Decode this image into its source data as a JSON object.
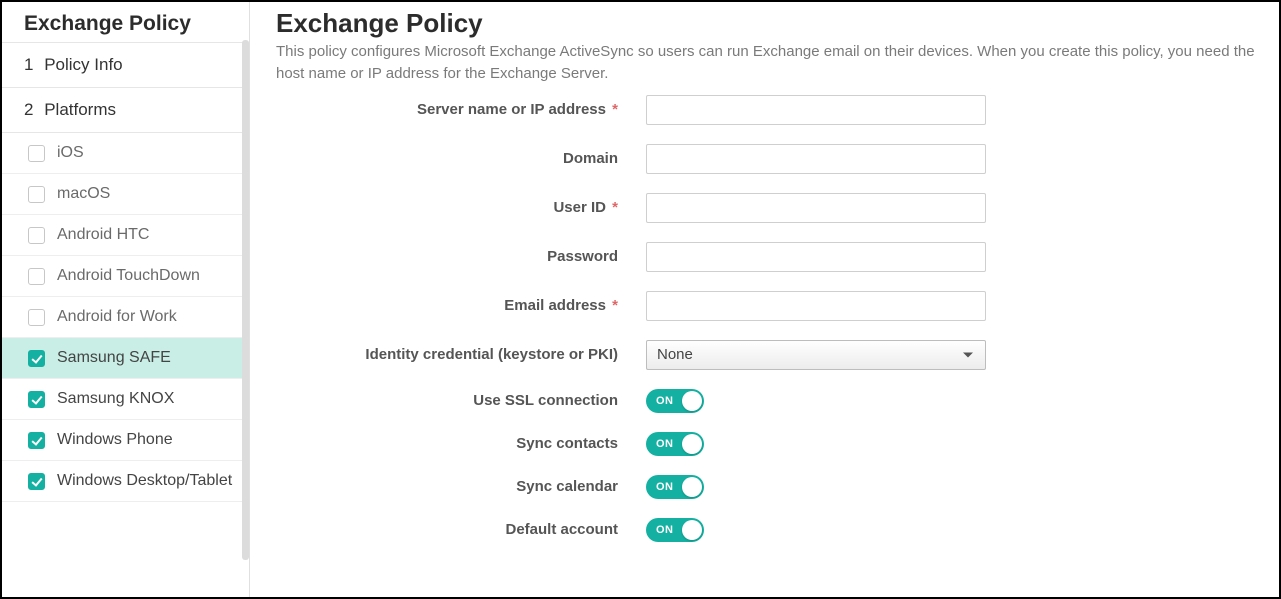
{
  "sidebar": {
    "title": "Exchange Policy",
    "steps": [
      {
        "num": "1",
        "label": "Policy Info"
      },
      {
        "num": "2",
        "label": "Platforms"
      }
    ],
    "platforms": [
      {
        "label": "iOS",
        "checked": false,
        "active": false
      },
      {
        "label": "macOS",
        "checked": false,
        "active": false
      },
      {
        "label": "Android HTC",
        "checked": false,
        "active": false
      },
      {
        "label": "Android TouchDown",
        "checked": false,
        "active": false
      },
      {
        "label": "Android for Work",
        "checked": false,
        "active": false
      },
      {
        "label": "Samsung SAFE",
        "checked": true,
        "active": true
      },
      {
        "label": "Samsung KNOX",
        "checked": true,
        "active": false
      },
      {
        "label": "Windows Phone",
        "checked": true,
        "active": false
      },
      {
        "label": "Windows Desktop/Tablet",
        "checked": true,
        "active": false
      }
    ]
  },
  "main": {
    "title": "Exchange Policy",
    "description": "This policy configures Microsoft Exchange ActiveSync so users can run Exchange email on their devices. When you create this policy, you need the host name or IP address for the Exchange Server.",
    "fields": {
      "server_label": "Server name or IP address",
      "server_value": "",
      "domain_label": "Domain",
      "domain_value": "",
      "userid_label": "User ID",
      "userid_value": "",
      "password_label": "Password",
      "password_value": "",
      "email_label": "Email address",
      "email_value": "",
      "identity_label": "Identity credential (keystore or PKI)",
      "identity_value": "None",
      "ssl_label": "Use SSL connection",
      "sync_contacts_label": "Sync contacts",
      "sync_calendar_label": "Sync calendar",
      "default_account_label": "Default account"
    },
    "toggle_states": {
      "ssl": "ON",
      "sync_contacts": "ON",
      "sync_calendar": "ON",
      "default_account": "ON"
    }
  }
}
